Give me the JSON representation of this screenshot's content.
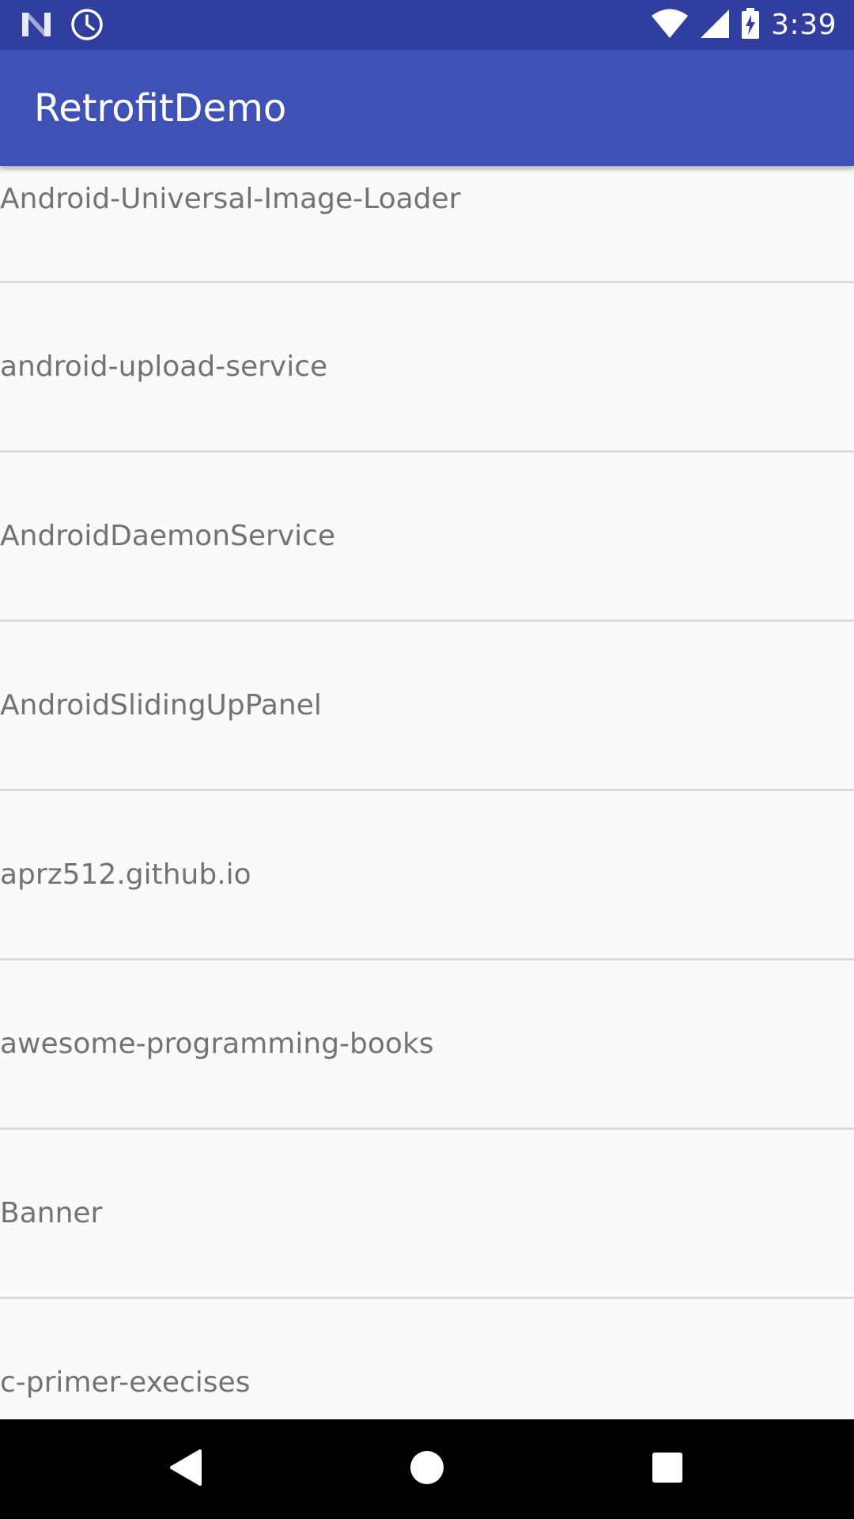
{
  "status_bar": {
    "left_icons": [
      "n-logo-icon",
      "alarm-clock-icon"
    ],
    "right_icons": [
      "wifi-icon",
      "cell-signal-icon",
      "battery-charging-icon"
    ],
    "time": "3:39"
  },
  "app_bar": {
    "title": "RetrofitDemo",
    "color": "#3f51b5"
  },
  "list": {
    "items": [
      "Android-Universal-Image-Loader",
      "android-upload-service",
      "AndroidDaemonService",
      "AndroidSlidingUpPanel",
      "aprz512.github.io",
      "awesome-programming-books",
      "Banner",
      "c-primer-execises"
    ]
  },
  "nav_bar": {
    "buttons": [
      "back-icon",
      "home-icon",
      "recents-icon"
    ]
  },
  "colors": {
    "status_bar": "#303f9f",
    "primary": "#3f51b5",
    "background": "#fafafa",
    "item_text": "#737373",
    "divider": "#dcdcdc"
  }
}
